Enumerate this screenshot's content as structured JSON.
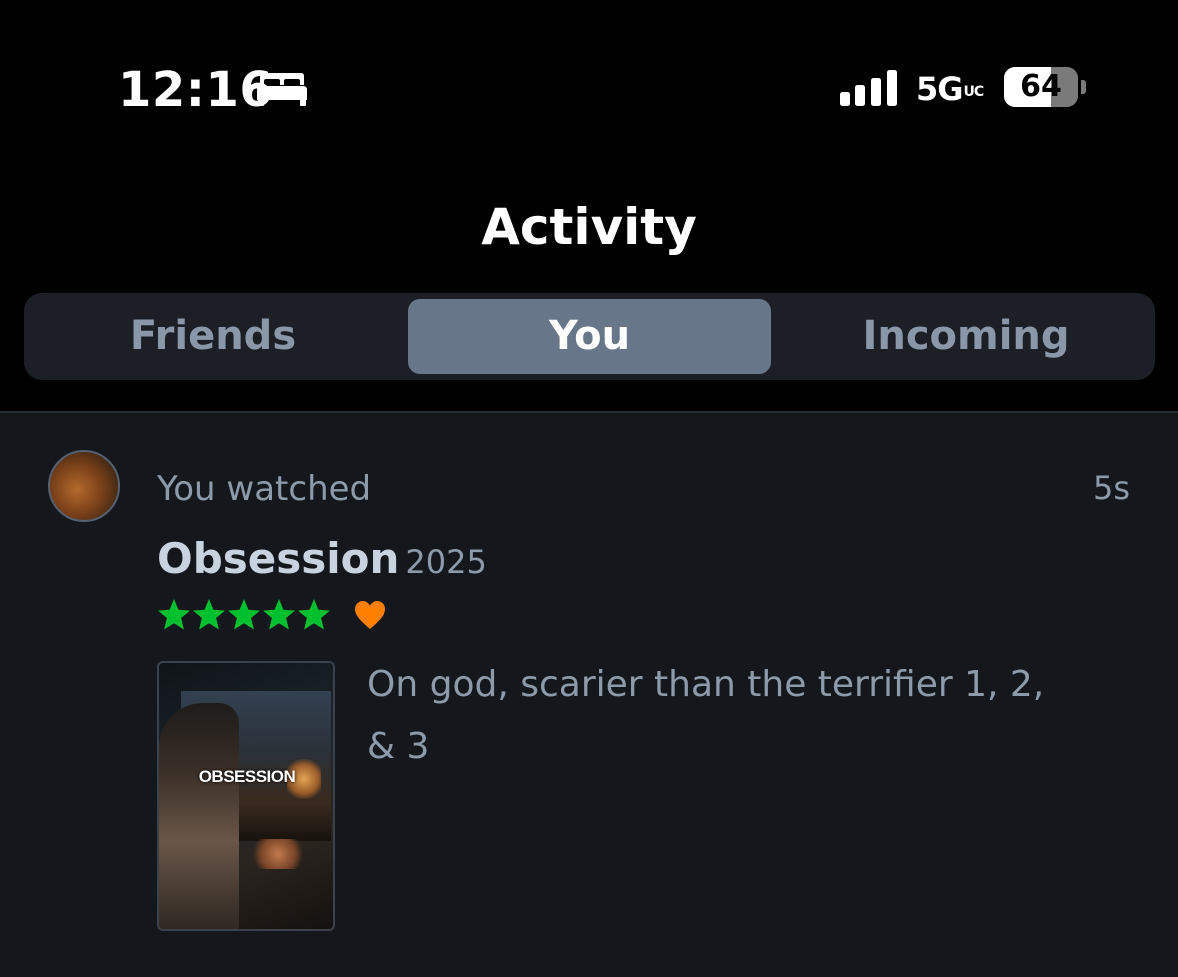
{
  "status_bar": {
    "time": "12:16",
    "focus_icon": "bed-icon",
    "signal_icon": "cellular-signal-icon",
    "network": "5G",
    "network_suffix": "UC",
    "battery_percent": "64",
    "battery_level": 0.64
  },
  "header": {
    "title": "Activity"
  },
  "tabs": [
    {
      "label": "Friends",
      "selected": false
    },
    {
      "label": "You",
      "selected": true
    },
    {
      "label": "Incoming",
      "selected": false
    }
  ],
  "activity": [
    {
      "action": "You watched",
      "time_ago": "5s",
      "film_title": "Obsession",
      "film_year": "2025",
      "rating_stars": 5,
      "liked": true,
      "poster_title": "OBSESSION",
      "review": "On god, scarier than the terrifier 1, 2, & 3"
    }
  ],
  "colors": {
    "background": "#000000",
    "list_background": "#14181c",
    "segment_selected": "#677789",
    "star": "#00c030",
    "heart": "#ff8000",
    "muted_text": "#8d9aaa"
  }
}
